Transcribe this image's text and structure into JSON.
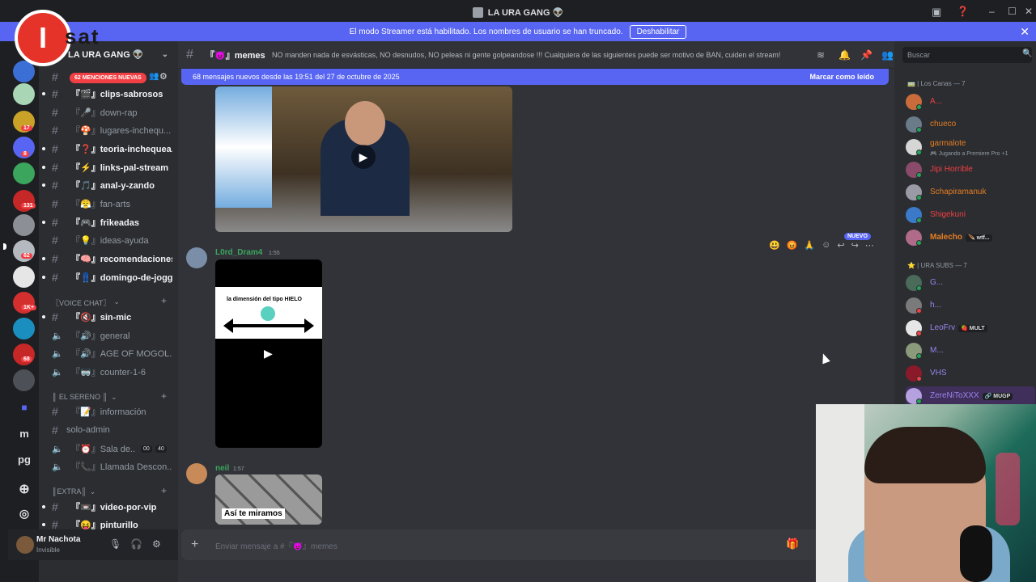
{
  "window": {
    "title": "LA URA GANG 👽",
    "min": "–",
    "max": "☐",
    "close": "✕"
  },
  "banner": {
    "text": "El modo Streamer está habilitado. Los nombres de usuario se han truncado.",
    "button": "Deshabilitar",
    "close": "✕"
  },
  "logo": {
    "letter": "I",
    "text": "sat"
  },
  "guilds": {
    "badges": [
      "17",
      "8",
      "131",
      "62",
      "1K+",
      "68"
    ],
    "icons": [
      "m",
      "pg"
    ]
  },
  "server": {
    "name": "LA URA GANG 👽",
    "chevron": "⌄",
    "mentions_pill": "62 MENCIONES NUEVAS"
  },
  "channels": [
    {
      "name": "『🎬』clips-sabrosos",
      "kind": "text",
      "unread": true
    },
    {
      "name": "『🎤』down-rap",
      "kind": "text",
      "unread": false
    },
    {
      "name": "『🍄』lugares-inchequ...",
      "kind": "text",
      "unread": false
    },
    {
      "name": "『❓』teoria-inchequea...",
      "kind": "text",
      "unread": true
    },
    {
      "name": "『⚡』links-pal-stream",
      "kind": "text",
      "unread": true
    },
    {
      "name": "『🎵』anal-y-zando",
      "kind": "text",
      "unread": true
    },
    {
      "name": "『😤』fan-arts",
      "kind": "text",
      "unread": false
    },
    {
      "name": "『🎮』frikeadas",
      "kind": "text",
      "unread": true
    },
    {
      "name": "『💡』ideas-ayuda",
      "kind": "text",
      "unread": false
    },
    {
      "name": "『🧠』recomendaciones",
      "kind": "text",
      "unread": true
    },
    {
      "name": "『👖』domingo-de-joggin",
      "kind": "text",
      "unread": true
    }
  ],
  "voice_category": {
    "label": "〖VOICE CHAT〗",
    "chevron": "⌄",
    "plus": "+",
    "channels": [
      {
        "name": "『🔇』sin-mic",
        "kind": "text",
        "unread": true
      },
      {
        "name": "『🔊』general",
        "kind": "voice"
      },
      {
        "name": "『🔊』AGE OF MOGOL...",
        "kind": "voice"
      },
      {
        "name": "『🥽』counter-1-6",
        "kind": "voice"
      }
    ]
  },
  "sereno_category": {
    "label": "║ EL SERENO ║",
    "chevron": "⌄",
    "plus": "+",
    "channels": [
      {
        "name": "『📝』información",
        "kind": "text"
      },
      {
        "name": "solo-admin",
        "kind": "text"
      },
      {
        "name": "『⏰』Sala de...",
        "kind": "voice",
        "count_a": "00",
        "count_b": "40"
      },
      {
        "name": "『📞』Llamada Descon...",
        "kind": "voice"
      }
    ]
  },
  "extra_category": {
    "label": "║EXTRA║",
    "chevron": "⌄",
    "plus": "+",
    "channels": [
      {
        "name": "『📼』video-por-vip",
        "kind": "text",
        "unread": true
      },
      {
        "name": "『😝』pinturillo",
        "kind": "text",
        "unread": true
      }
    ]
  },
  "user": {
    "name": "Mr Nachota",
    "status": "Invisible"
  },
  "chat": {
    "channel": "『😈』memes",
    "topic": "NO manden nada de esvásticas, NO desnudos, NO peleas ni gente golpeandose !!! Cualquiera de las siguientes puede ser motivo de BAN, cuiden el stream!",
    "new_messages": "68 mensajes nuevos desde las 19:51 del 27 de octubre de 2025",
    "mark_read": "Marcar como leído",
    "nuevo": "NUEVO",
    "messages": [
      {
        "author": "L0rd_Dram4",
        "time": "1:55",
        "color": "#3ba55d",
        "video_title": "la dimensión del tipo HIELO"
      },
      {
        "author": "neil",
        "time": "1:57",
        "color": "#3ba55d",
        "image_caption": "Así te miramos"
      }
    ],
    "composer_placeholder": "Enviar mensaje a #『😈』memes"
  },
  "members": {
    "search_placeholder": "Buscar",
    "groups": [
      {
        "title": "🚃 | Los Canas — 7",
        "items": [
          {
            "name": "A...",
            "color": "#f23f43",
            "status": "#23a55a"
          },
          {
            "name": "chueco",
            "color": "#e67e22",
            "status": "#23a55a"
          },
          {
            "name": "garmalote",
            "color": "#e67e22",
            "status": "#23a55a",
            "sub": "🎮 Jugando a Premiere Pro +1"
          },
          {
            "name": "Jipi Horrible",
            "color": "#f23f43",
            "status": "#23a55a"
          },
          {
            "name": "Schapiramanuk",
            "color": "#e67e22",
            "status": "#23a55a"
          },
          {
            "name": "Shigekuni",
            "color": "#f23f43",
            "status": "#23a55a"
          },
          {
            "name": "Malecho",
            "color": "#e67e22",
            "status": "#23a55a",
            "tag": "🪶 wtf..."
          }
        ]
      },
      {
        "title": "⭐ | URA SUBS — 7",
        "items": [
          {
            "name": "G...",
            "color": "#9b84ec",
            "status": "#23a55a"
          },
          {
            "name": "h...",
            "color": "#9b84ec",
            "status": "#f23f43"
          },
          {
            "name": "LeoFrv",
            "color": "#9b84ec",
            "status": "#f23f43",
            "tag": "🍓 MULT"
          },
          {
            "name": "M...",
            "color": "#9b84ec",
            "status": "#23a55a"
          },
          {
            "name": "VHS",
            "color": "#9b84ec",
            "status": "#f23f43"
          },
          {
            "name": "ZereNiToXXX",
            "color": "#9b84ec",
            "status": "#23a55a",
            "tag": "🔗 MUGP"
          }
        ]
      }
    ]
  }
}
